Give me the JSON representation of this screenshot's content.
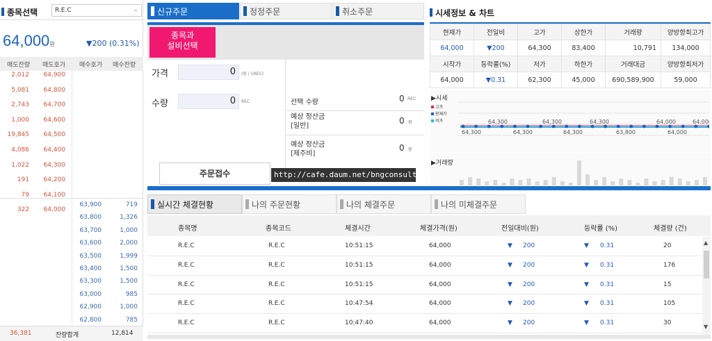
{
  "stock_select": {
    "title": "종목선택",
    "value": "R.E.C"
  },
  "current": {
    "price": "64,000",
    "unit": "원",
    "change": "▼200 (0.31%)"
  },
  "orderbook": {
    "headers": [
      "매도잔량",
      "매도호가",
      "매수호가",
      "매수잔량"
    ],
    "asks": [
      {
        "qty": "2,012",
        "price": "64,900"
      },
      {
        "qty": "5,081",
        "price": "64,800"
      },
      {
        "qty": "2,743",
        "price": "64,700"
      },
      {
        "qty": "1,000",
        "price": "64,600"
      },
      {
        "qty": "19,845",
        "price": "64,500"
      },
      {
        "qty": "4,086",
        "price": "64,400"
      },
      {
        "qty": "1,022",
        "price": "64,300"
      },
      {
        "qty": "191",
        "price": "64,200"
      },
      {
        "qty": "79",
        "price": "64,100"
      },
      {
        "qty": "322",
        "price": "64,000"
      }
    ],
    "bids": [
      {
        "price": "63,900",
        "qty": "719"
      },
      {
        "price": "63,800",
        "qty": "1,326"
      },
      {
        "price": "63,700",
        "qty": "1,000"
      },
      {
        "price": "63,600",
        "qty": "2,000"
      },
      {
        "price": "63,500",
        "qty": "1,999"
      },
      {
        "price": "63,400",
        "qty": "1,500"
      },
      {
        "price": "63,300",
        "qty": "1,500"
      },
      {
        "price": "63,000",
        "qty": "985"
      },
      {
        "price": "62,900",
        "qty": "1,000"
      },
      {
        "price": "62,800",
        "qty": "785"
      }
    ],
    "total_ask": "36,381",
    "total_label": "잔량합계",
    "total_bid": "12,814"
  },
  "order_tabs": [
    "신규주문",
    "정정주문",
    "취소주문"
  ],
  "order": {
    "select_btn": "종목과\n설비선택",
    "price_label": "가격",
    "price_value": "0",
    "price_unit": "(원 / 1REC)",
    "qty_label": "수량",
    "qty_value": "0",
    "qty_unit": "REC",
    "sel_qty_label": "선택 수량",
    "sel_qty_value": "0",
    "sel_qty_unit": "REC",
    "est_normal_label": "예상 정산금\n[일반]",
    "est_normal_value": "0",
    "est_jeju_label": "예상 정산금\n[제주비]",
    "est_jeju_value": "0",
    "won": "원",
    "submit": "주문접수",
    "watermark": "http://cafe.daum.net/bngconsulting"
  },
  "market": {
    "title": "시세정보 & 차트",
    "row1_h": [
      "현재가",
      "전일비",
      "고가",
      "상한가",
      "거래량",
      "양방향최고가"
    ],
    "row1_v": [
      "64,000",
      "▼200",
      "64,300",
      "83,400",
      "10,791",
      "134,000"
    ],
    "row2_h": [
      "시작가",
      "등락률(%)",
      "저가",
      "하한가",
      "거래대금",
      "양방향최저가"
    ],
    "row2_v": [
      "64,000",
      "▼0.31",
      "62,300",
      "45,000",
      "690,589,900",
      "59,000"
    ],
    "chart_label": "▶시세",
    "legend": [
      {
        "name": "고가",
        "color": "#e0245e"
      },
      {
        "name": "현재가",
        "color": "#1f5fbf"
      },
      {
        "name": "저가",
        "color": "#29b6e8"
      }
    ],
    "chart_labels_top": [
      "64,300",
      "64,300",
      "64,300",
      "64,000",
      "64,000"
    ],
    "chart_labels_bot": [
      "64,300",
      "64,300",
      "64,300",
      "63,800",
      "64,000"
    ],
    "volume_label": "▶거래량",
    "volume": [
      4,
      6,
      5,
      3,
      4,
      2,
      5,
      4,
      5,
      3,
      4,
      6,
      3,
      2,
      18,
      8,
      4,
      6,
      3,
      5,
      4,
      2,
      5,
      3,
      4,
      6,
      5,
      3,
      4,
      6
    ]
  },
  "trade_tabs": [
    "실시간 체결현황",
    "나의 주문현황",
    "나의 체결주문",
    "나의 미체결주문"
  ],
  "trades": {
    "headers": [
      "종목명",
      "종목코드",
      "체결시간",
      "체결가격(원)",
      "전일대비(원)",
      "등락률 (%)",
      "체결량 (건)"
    ],
    "rows": [
      {
        "name": "R.E.C",
        "code": "R.E.C",
        "time": "10:51:15",
        "price": "64,000",
        "diff": "200",
        "rate": "0.31",
        "qty": "20"
      },
      {
        "name": "R.E.C",
        "code": "R.E.C",
        "time": "10:51:15",
        "price": "64,000",
        "diff": "200",
        "rate": "0.31",
        "qty": "176"
      },
      {
        "name": "R.E.C",
        "code": "R.E.C",
        "time": "10:51:15",
        "price": "64,000",
        "diff": "200",
        "rate": "0.31",
        "qty": "15"
      },
      {
        "name": "R.E.C",
        "code": "R.E.C",
        "time": "10:47:54",
        "price": "64,000",
        "diff": "200",
        "rate": "0.31",
        "qty": "105"
      },
      {
        "name": "R.E.C",
        "code": "R.E.C",
        "time": "10:47:40",
        "price": "64,000",
        "diff": "200",
        "rate": "0.31",
        "qty": "30"
      }
    ]
  }
}
